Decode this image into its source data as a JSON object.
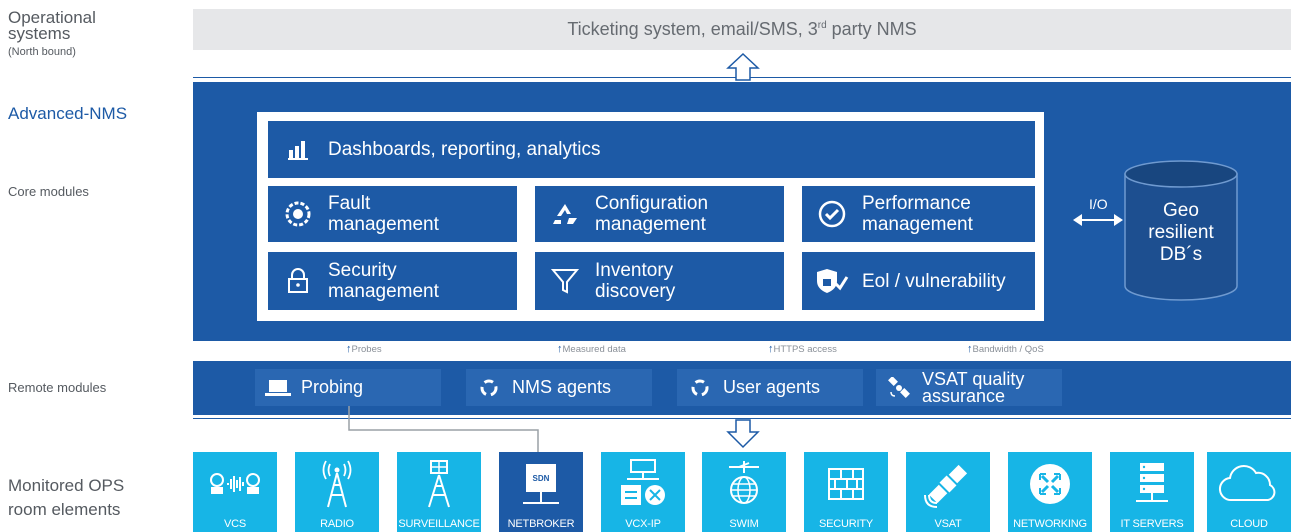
{
  "left_labels": {
    "operational": "Operational systems",
    "operational_note": "(North bound)",
    "advanced_nms": "Advanced-NMS",
    "core_modules": "Core modules",
    "remote_modules": "Remote modules",
    "monitored": "Monitored OPS room elements"
  },
  "north_bar": {
    "text_before": "Ticketing system, email/SMS, 3",
    "superscript": "rd",
    "text_after": " party NMS"
  },
  "core": {
    "dashboards": "Dashboards, reporting, analytics",
    "modules": [
      {
        "line1": "Fault",
        "line2": "management",
        "icon": "fault-gear-icon"
      },
      {
        "line1": "Configuration",
        "line2": "management",
        "icon": "recycle-icon"
      },
      {
        "line1": "Performance",
        "line2": "management",
        "icon": "check-badge-icon"
      },
      {
        "line1": "Security",
        "line2": "management",
        "icon": "padlock-icon"
      },
      {
        "line1": "Inventory",
        "line2": "discovery",
        "icon": "funnel-icon"
      },
      {
        "line1": "Eol / vulnerability",
        "line2": "",
        "icon": "shield-check-icon"
      }
    ]
  },
  "db": {
    "io_label": "I/O",
    "line1": "Geo",
    "line2": "resilient",
    "line3": "DB´s"
  },
  "flows": [
    "Probes",
    "Measured data",
    "HTTPS access",
    "Bandwidth / QoS"
  ],
  "remote": [
    {
      "label": "Probing",
      "icon": "laptop-icon"
    },
    {
      "label": "NMS agents",
      "icon": "cycle-icon"
    },
    {
      "label": "User agents",
      "icon": "cycle-icon"
    },
    {
      "label_line1": "VSAT quality",
      "label_line2": "assurance",
      "icon": "satellite-icon"
    }
  ],
  "tiles": [
    {
      "name": "VCS",
      "color": "#17b5e6"
    },
    {
      "name": "RADIO",
      "color": "#17b5e6"
    },
    {
      "name": "SURVEILLANCE",
      "color": "#17b5e6"
    },
    {
      "name": "NETBROKER",
      "badge": "SDN",
      "color": "#1d5aa6"
    },
    {
      "name": "VCX-IP",
      "color": "#17b5e6"
    },
    {
      "name": "SWIM",
      "color": "#17b5e6"
    },
    {
      "name": "SECURITY",
      "color": "#17b5e6"
    },
    {
      "name": "VSAT",
      "color": "#17b5e6"
    },
    {
      "name": "NETWORKING",
      "color": "#17b5e6"
    },
    {
      "name": "IT SERVERS",
      "color": "#17b5e6"
    },
    {
      "name": "CLOUD",
      "color": "#17b5e6"
    }
  ],
  "colors": {
    "main_blue": "#1d5aa6",
    "tile_cyan": "#17b5e6",
    "north_gray": "#e6e7e9"
  }
}
